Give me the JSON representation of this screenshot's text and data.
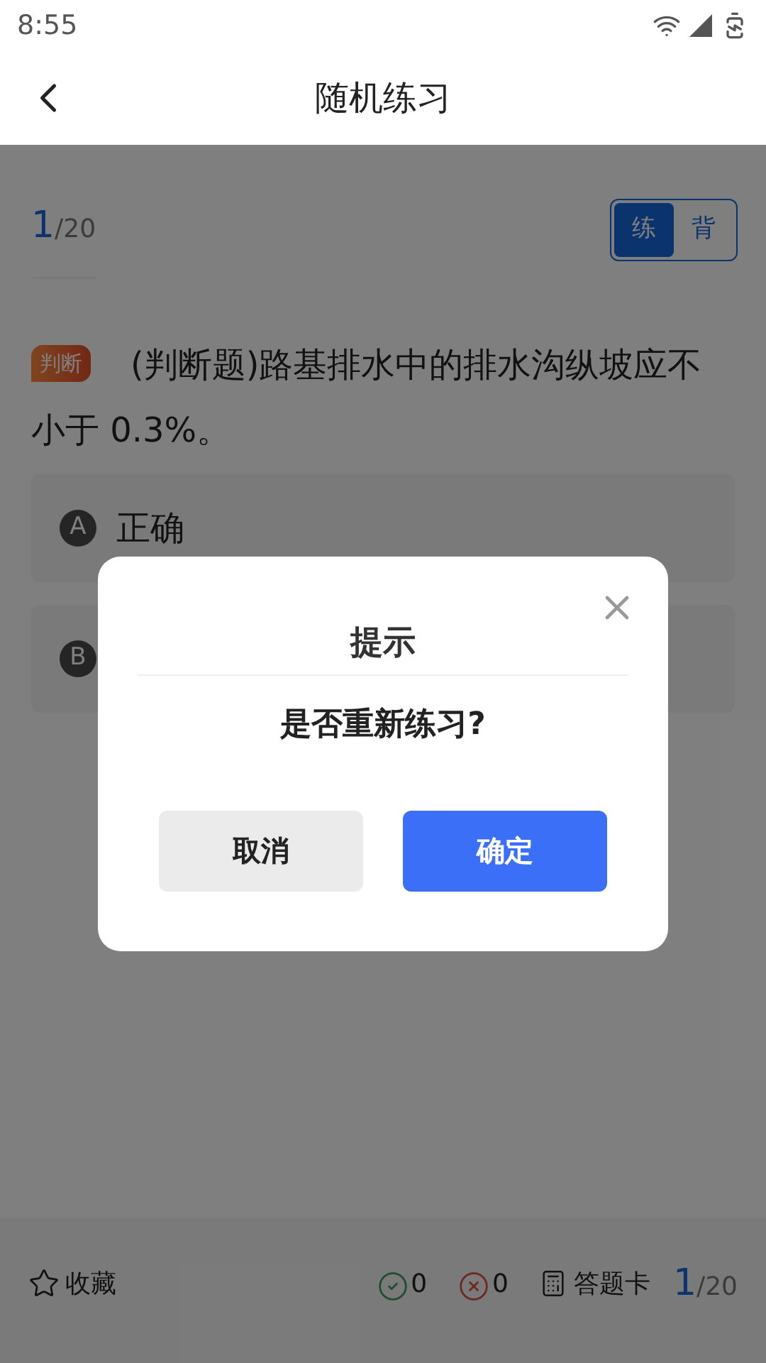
{
  "status_bar": {
    "time": "8:55"
  },
  "header": {
    "title": "随机练习"
  },
  "progress": {
    "current": "1",
    "total": "/20"
  },
  "mode_tabs": [
    {
      "label": "练",
      "selected": true
    },
    {
      "label": "背",
      "selected": false
    }
  ],
  "question": {
    "tag": "判断",
    "text": "(判断题)路基排水中的排水沟纵坡应不小于 0.3%。"
  },
  "options": [
    {
      "letter": "A",
      "text": "正确"
    },
    {
      "letter": "B"
    }
  ],
  "dialog": {
    "title": "提示",
    "message": "是否重新练习?",
    "buttons": [
      {
        "label": "取消",
        "kind": "secondary"
      },
      {
        "label": "确定",
        "kind": "primary"
      }
    ]
  },
  "bottom_bar": {
    "favorite": "收藏",
    "correct": "0",
    "wrong": "0",
    "answer_card": "答题卡",
    "current": "1",
    "total": "/20"
  }
}
